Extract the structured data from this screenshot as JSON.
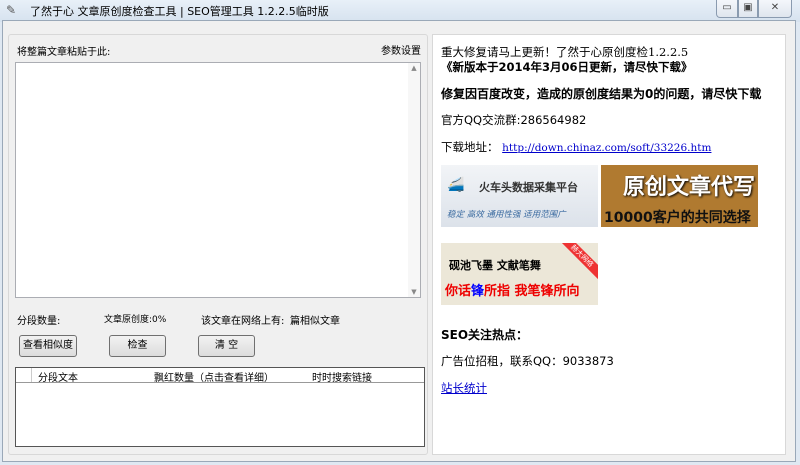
{
  "window": {
    "title": "了然于心 文章原创度检查工具 | SEO管理工具  1.2.2.5临时版"
  },
  "left": {
    "paste_label": "将整篇文章粘贴于此:",
    "settings_link": "参数设置",
    "article_text": "",
    "segment_count_label": "分段数量:",
    "originality_label": "文章原创度:0%",
    "similar_label": "该文章在网络上有:",
    "similar_suffix": "篇相似文章",
    "buttons": {
      "similarity": "查看相似度",
      "check": "检查",
      "clear": "清 空"
    },
    "columns": [
      "分段文本",
      "飘红数量（点击查看详细）",
      "时时搜索链接"
    ]
  },
  "right": {
    "notice": "重大修复请马上更新！了然于心原创度检1.2.2.5",
    "version_note": "《新版本于2014年3月06日更新，请尽快下载》",
    "fix_note": "修复因百度改变，造成的原创度结果为0的问题，请尽快下载",
    "qq_group": "官方QQ交流群:286564982",
    "download_label": "下载地址：",
    "download_url": "http://down.chinaz.com/soft/33226.htm",
    "ads": [
      {
        "title": "火车头数据采集平台",
        "sub": "稳定 高效 通用性强 适用范围广"
      },
      {
        "title": "原创文章代写",
        "sub": "10000客户的共同选择"
      },
      {
        "title": "砚池飞墨 文献笔舞",
        "sub_a": "你话",
        "sub_b": "锋",
        "sub_c": "所指  我笔锋所向",
        "ribbon": "赫大网络"
      }
    ],
    "seo_heading": "SEO关注热点：",
    "ad_rent": "广告位招租，联系QQ：9033873",
    "stats_link": "站长统计"
  }
}
